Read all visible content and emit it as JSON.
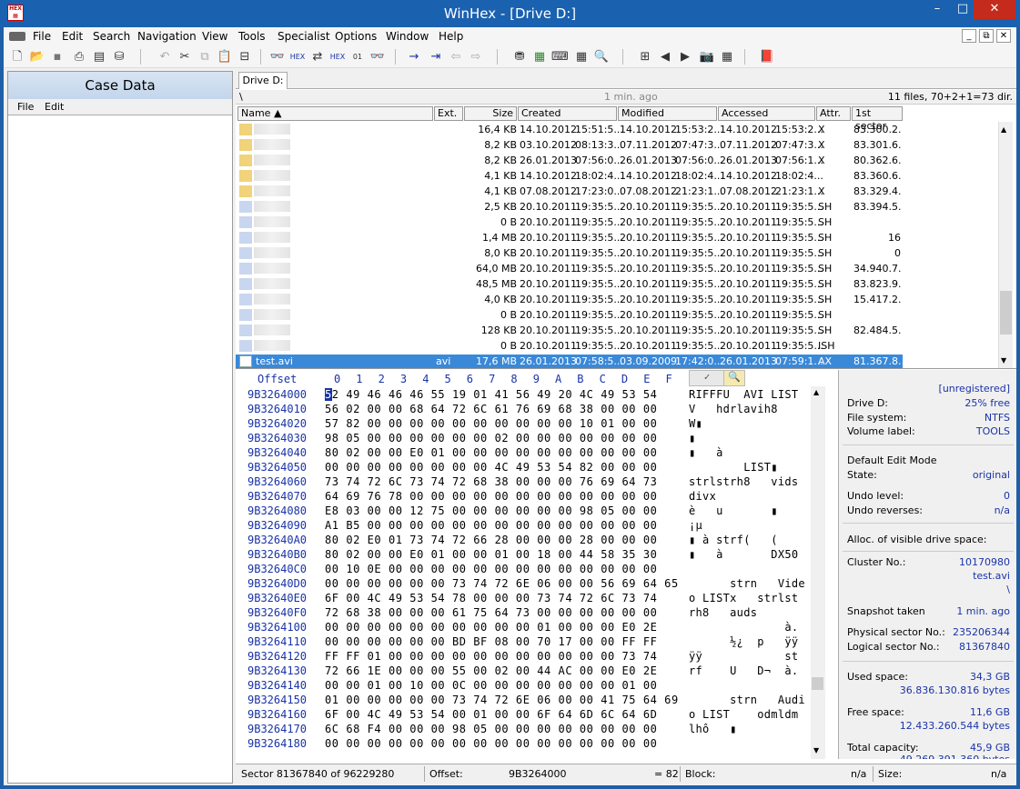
{
  "window": {
    "title": "WinHex - [Drive D:]",
    "min": "–",
    "max": "□",
    "close": "✕"
  },
  "menu": [
    "File",
    "Edit",
    "Search",
    "Navigation",
    "View",
    "Tools",
    "Specialist",
    "Options",
    "Window",
    "Help"
  ],
  "mdi": [
    "_",
    "⧉",
    "✕"
  ],
  "case": {
    "title": "Case Data",
    "menu": [
      "File",
      "Edit"
    ]
  },
  "tab": "Drive D:",
  "path": {
    "dir": "\\",
    "snapshot": "1 min. ago",
    "summary": "11 files, 70+2+1=73 dir."
  },
  "columns": [
    "Name",
    "Ext.",
    "Size",
    "Created",
    "Modified",
    "Accessed",
    "Attr.",
    "1st sector"
  ],
  "files": [
    {
      "type": "folder",
      "name": "",
      "ext": "",
      "size": "16,4 KB",
      "cd": "14.10.2012",
      "ct": "15:51:5...",
      "md": "14.10.2012",
      "mt": "15:53:2...",
      "ad": "14.10.2012",
      "at": "15:53:2...",
      "attr": "X",
      "sector": "83.300.2..."
    },
    {
      "type": "folder",
      "name": "",
      "ext": "",
      "size": "8,2 KB",
      "cd": "03.10.2012",
      "ct": "08:13:3...",
      "md": "07.11.2012",
      "mt": "07:47:3...",
      "ad": "07.11.2012",
      "at": "07:47:3...",
      "attr": "X",
      "sector": "83.301.6..."
    },
    {
      "type": "folder",
      "name": "",
      "ext": "",
      "size": "8,2 KB",
      "cd": "26.01.2013",
      "ct": "07:56:0...",
      "md": "26.01.2013",
      "mt": "07:56:0...",
      "ad": "26.01.2013",
      "at": "07:56:1...",
      "attr": "X",
      "sector": "80.362.6..."
    },
    {
      "type": "folder",
      "name": "",
      "ext": "",
      "size": "4,1 KB",
      "cd": "14.10.2012",
      "ct": "18:02:4...",
      "md": "14.10.2012",
      "mt": "18:02:4...",
      "ad": "14.10.2012",
      "at": "18:02:4...",
      "attr": "",
      "sector": "83.360.6..."
    },
    {
      "type": "folder",
      "name": "",
      "ext": "",
      "size": "4,1 KB",
      "cd": "07.08.2012",
      "ct": "17:23:0...",
      "md": "07.08.2012",
      "mt": "21:23:1...",
      "ad": "07.08.2012",
      "at": "21:23:1...",
      "attr": "X",
      "sector": "83.329.4..."
    },
    {
      "type": "sys",
      "name": "",
      "ext": "",
      "size": "2,5 KB",
      "cd": "20.10.2011",
      "ct": "19:35:5...",
      "md": "20.10.2011",
      "mt": "19:35:5...",
      "ad": "20.10.2011",
      "at": "19:35:5...",
      "attr": "SH",
      "sector": "83.394.5..."
    },
    {
      "type": "sys",
      "name": "",
      "ext": "",
      "size": "0 B",
      "cd": "20.10.2011",
      "ct": "19:35:5...",
      "md": "20.10.2011",
      "mt": "19:35:5...",
      "ad": "20.10.2011",
      "at": "19:35:5...",
      "attr": "SH",
      "sector": ""
    },
    {
      "type": "sys",
      "name": "",
      "ext": "",
      "size": "1,4 MB",
      "cd": "20.10.2011",
      "ct": "19:35:5...",
      "md": "20.10.2011",
      "mt": "19:35:5...",
      "ad": "20.10.2011",
      "at": "19:35:5...",
      "attr": "SH",
      "sector": "16"
    },
    {
      "type": "sys",
      "name": "",
      "ext": "",
      "size": "8,0 KB",
      "cd": "20.10.2011",
      "ct": "19:35:5...",
      "md": "20.10.2011",
      "mt": "19:35:5...",
      "ad": "20.10.2011",
      "at": "19:35:5...",
      "attr": "SH",
      "sector": "0"
    },
    {
      "type": "sys",
      "name": "",
      "ext": "",
      "size": "64,0 MB",
      "cd": "20.10.2011",
      "ct": "19:35:5...",
      "md": "20.10.2011",
      "mt": "19:35:5...",
      "ad": "20.10.2011",
      "at": "19:35:5...",
      "attr": "SH",
      "sector": "34.940.7..."
    },
    {
      "type": "sys",
      "name": "",
      "ext": "",
      "size": "48,5 MB",
      "cd": "20.10.2011",
      "ct": "19:35:5...",
      "md": "20.10.2011",
      "mt": "19:35:5...",
      "ad": "20.10.2011",
      "at": "19:35:5...",
      "attr": "SH",
      "sector": "83.823.9..."
    },
    {
      "type": "sys",
      "name": "",
      "ext": "",
      "size": "4,0 KB",
      "cd": "20.10.2011",
      "ct": "19:35:5...",
      "md": "20.10.2011",
      "mt": "19:35:5...",
      "ad": "20.10.2011",
      "at": "19:35:5...",
      "attr": "SH",
      "sector": "15.417.2..."
    },
    {
      "type": "sys",
      "name": "",
      "ext": "",
      "size": "0 B",
      "cd": "20.10.2011",
      "ct": "19:35:5...",
      "md": "20.10.2011",
      "mt": "19:35:5...",
      "ad": "20.10.2011",
      "at": "19:35:5...",
      "attr": "SH",
      "sector": ""
    },
    {
      "type": "sys",
      "name": "",
      "ext": "",
      "size": "128 KB",
      "cd": "20.10.2011",
      "ct": "19:35:5...",
      "md": "20.10.2011",
      "mt": "19:35:5...",
      "ad": "20.10.2011",
      "at": "19:35:5...",
      "attr": "SH",
      "sector": "82.484.5..."
    },
    {
      "type": "sys",
      "name": "",
      "ext": "",
      "size": "0 B",
      "cd": "20.10.2011",
      "ct": "19:35:5...",
      "md": "20.10.2011",
      "mt": "19:35:5...",
      "ad": "20.10.2011",
      "at": "19:35:5...",
      "attr": "ISH",
      "sector": ""
    },
    {
      "type": "file",
      "name": "test.avi",
      "ext": "avi",
      "size": "17,6 MB",
      "cd": "26.01.2013",
      "ct": "07:58:5...",
      "md": "03.09.2009",
      "mt": "17:42:0...",
      "ad": "26.01.2013",
      "at": "07:59:1...",
      "attr": "AX",
      "sector": "81.367.8...",
      "selected": true
    }
  ],
  "hex_header": {
    "offset": "Offset",
    "cols": [
      "0",
      "1",
      "2",
      "3",
      "4",
      "5",
      "6",
      "7",
      "8",
      "9",
      "A",
      "B",
      "C",
      "D",
      "E",
      "F"
    ]
  },
  "hex": [
    [
      "9B3264000",
      "52 49 46 46 46 55 19 01 41 56 49 20 4C 49 53 54",
      "RIFFFU  AVI LIST"
    ],
    [
      "9B3264010",
      "56 02 00 00 68 64 72 6C 61 76 69 68 38 00 00 00",
      "V   hdrlavih8   "
    ],
    [
      "9B3264020",
      "57 82 00 00 00 00 00 00 00 00 00 00 10 01 00 00",
      "W▮              "
    ],
    [
      "9B3264030",
      "98 05 00 00 00 00 00 00 02 00 00 00 00 00 00 00",
      "▮               "
    ],
    [
      "9B3264040",
      "80 02 00 00 E0 01 00 00 00 00 00 00 00 00 00 00",
      "▮   à           "
    ],
    [
      "9B3264050",
      "00 00 00 00 00 00 00 00 4C 49 53 54 82 00 00 00",
      "        LIST▮   "
    ],
    [
      "9B3264060",
      "73 74 72 6C 73 74 72 68 38 00 00 00 76 69 64 73",
      "strlstrh8   vids"
    ],
    [
      "9B3264070",
      "64 69 76 78 00 00 00 00 00 00 00 00 00 00 00 00",
      "divx            "
    ],
    [
      "9B3264080",
      "E8 03 00 00 12 75 00 00 00 00 00 00 98 05 00 00",
      "è   u       ▮   "
    ],
    [
      "9B3264090",
      "A1 B5 00 00 00 00 00 00 00 00 00 00 00 00 00 00",
      "¡µ              "
    ],
    [
      "9B32640A0",
      "80 02 E0 01 73 74 72 66 28 00 00 00 28 00 00 00",
      "▮ à strf(   (   "
    ],
    [
      "9B32640B0",
      "80 02 00 00 E0 01 00 00 01 00 18 00 44 58 35 30",
      "▮   à       DX50"
    ],
    [
      "9B32640C0",
      "00 10 0E 00 00 00 00 00 00 00 00 00 00 00 00 00",
      "                "
    ],
    [
      "9B32640D0",
      "00 00 00 00 00 00 73 74 72 6E 06 00 00 56 69 64 65",
      "      strn   Vide"
    ],
    [
      "9B32640E0",
      "6F 00 4C 49 53 54 78 00 00 00 73 74 72 6C 73 74",
      "o LISTx   strlst"
    ],
    [
      "9B32640F0",
      "72 68 38 00 00 00 61 75 64 73 00 00 00 00 00 00",
      "rh8   auds      "
    ],
    [
      "9B3264100",
      "00 00 00 00 00 00 00 00 00 00 01 00 00 00 E0 2E",
      "              à."
    ],
    [
      "9B3264110",
      "00 00 00 00 00 00 BD BF 08 00 70 17 00 00 FF FF",
      "      ½¿  p   ÿÿ"
    ],
    [
      "9B3264120",
      "FF FF 01 00 00 00 00 00 00 00 00 00 00 00 73 74",
      "ÿÿ            st"
    ],
    [
      "9B3264130",
      "72 66 1E 00 00 00 55 00 02 00 44 AC 00 00 E0 2E",
      "rf    U   D¬  à."
    ],
    [
      "9B3264140",
      "00 00 01 00 10 00 0C 00 00 00 00 00 00 00 01 00",
      "                "
    ],
    [
      "9B3264150",
      "01 00 00 00 00 00 73 74 72 6E 06 00 00 41 75 64 69",
      "      strn   Audi"
    ],
    [
      "9B3264160",
      "6F 00 4C 49 53 54 00 01 00 00 6F 64 6D 6C 64 6D",
      "o LIST    odmldm"
    ],
    [
      "9B3264170",
      "6C 68 F4 00 00 00 98 05 00 00 00 00 00 00 00 00",
      "lhô   ▮         "
    ],
    [
      "9B3264180",
      "00 00 00 00 00 00 00 00 00 00 00 00 00 00 00 00",
      "                "
    ]
  ],
  "info": {
    "unregistered": "[unregistered]",
    "drive_l": "Drive D:",
    "drive_v": "25% free",
    "fs_l": "File system:",
    "fs_v": "NTFS",
    "vol_l": "Volume label:",
    "vol_v": "TOOLS",
    "mode_l": "Default Edit Mode",
    "state_l": "State:",
    "state_v": "original",
    "undo_l": "Undo level:",
    "undo_v": "0",
    "undorev_l": "Undo reverses:",
    "undorev_v": "n/a",
    "alloc_l": "Alloc. of visible drive space:",
    "cluster_l": "Cluster No.:",
    "cluster_v": "10170980",
    "cluster_file": "test.avi",
    "cluster_path": "\\",
    "snap_l": "Snapshot taken",
    "snap_v": "1 min. ago",
    "phys_l": "Physical sector No.:",
    "phys_v": "235206344",
    "log_l": "Logical sector No.:",
    "log_v": "81367840",
    "used_l": "Used space:",
    "used_v": "34,3 GB",
    "used_b": "36.836.130.816 bytes",
    "free_l": "Free space:",
    "free_v": "11,6 GB",
    "free_b": "12.433.260.544 bytes",
    "total_l": "Total capacity:",
    "total_v": "45,9 GB",
    "total_b": "49.269.391.360 bytes"
  },
  "status": {
    "sector": "Sector 81367840 of 96229280",
    "offset_l": "Offset:",
    "offset_v": "9B3264000",
    "eq": "= 82",
    "block_l": "Block:",
    "block_v": "n/a",
    "size_l": "Size:",
    "size_v": "n/a"
  }
}
